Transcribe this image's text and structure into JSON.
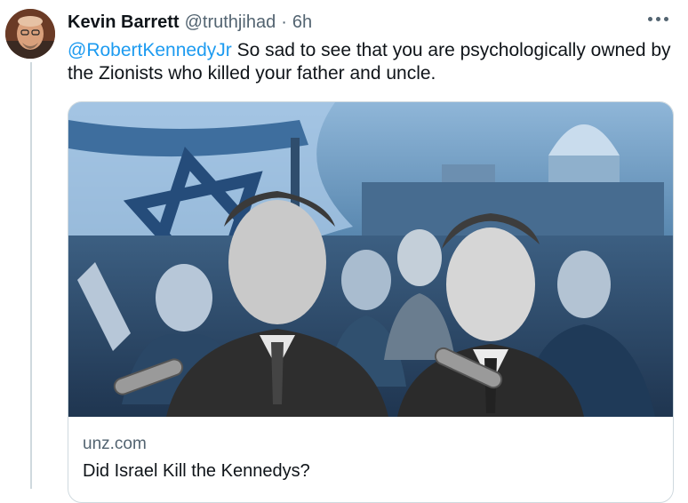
{
  "tweet": {
    "author_name": "Kevin Barrett",
    "handle": "@truthjihad",
    "separator": "·",
    "time": "6h",
    "mention": "@RobertKennedyJr",
    "text": "So sad to see that you are psychologically owned by the Zionists who killed your father and uncle."
  },
  "card": {
    "domain": "unz.com",
    "title": "Did Israel Kill the Kennedys?"
  },
  "icons": {
    "more": "more-horizontal-icon"
  },
  "colors": {
    "accent": "#1d9bf0",
    "text": "#0f1419",
    "secondary": "#536471",
    "border": "#cfd9de"
  }
}
